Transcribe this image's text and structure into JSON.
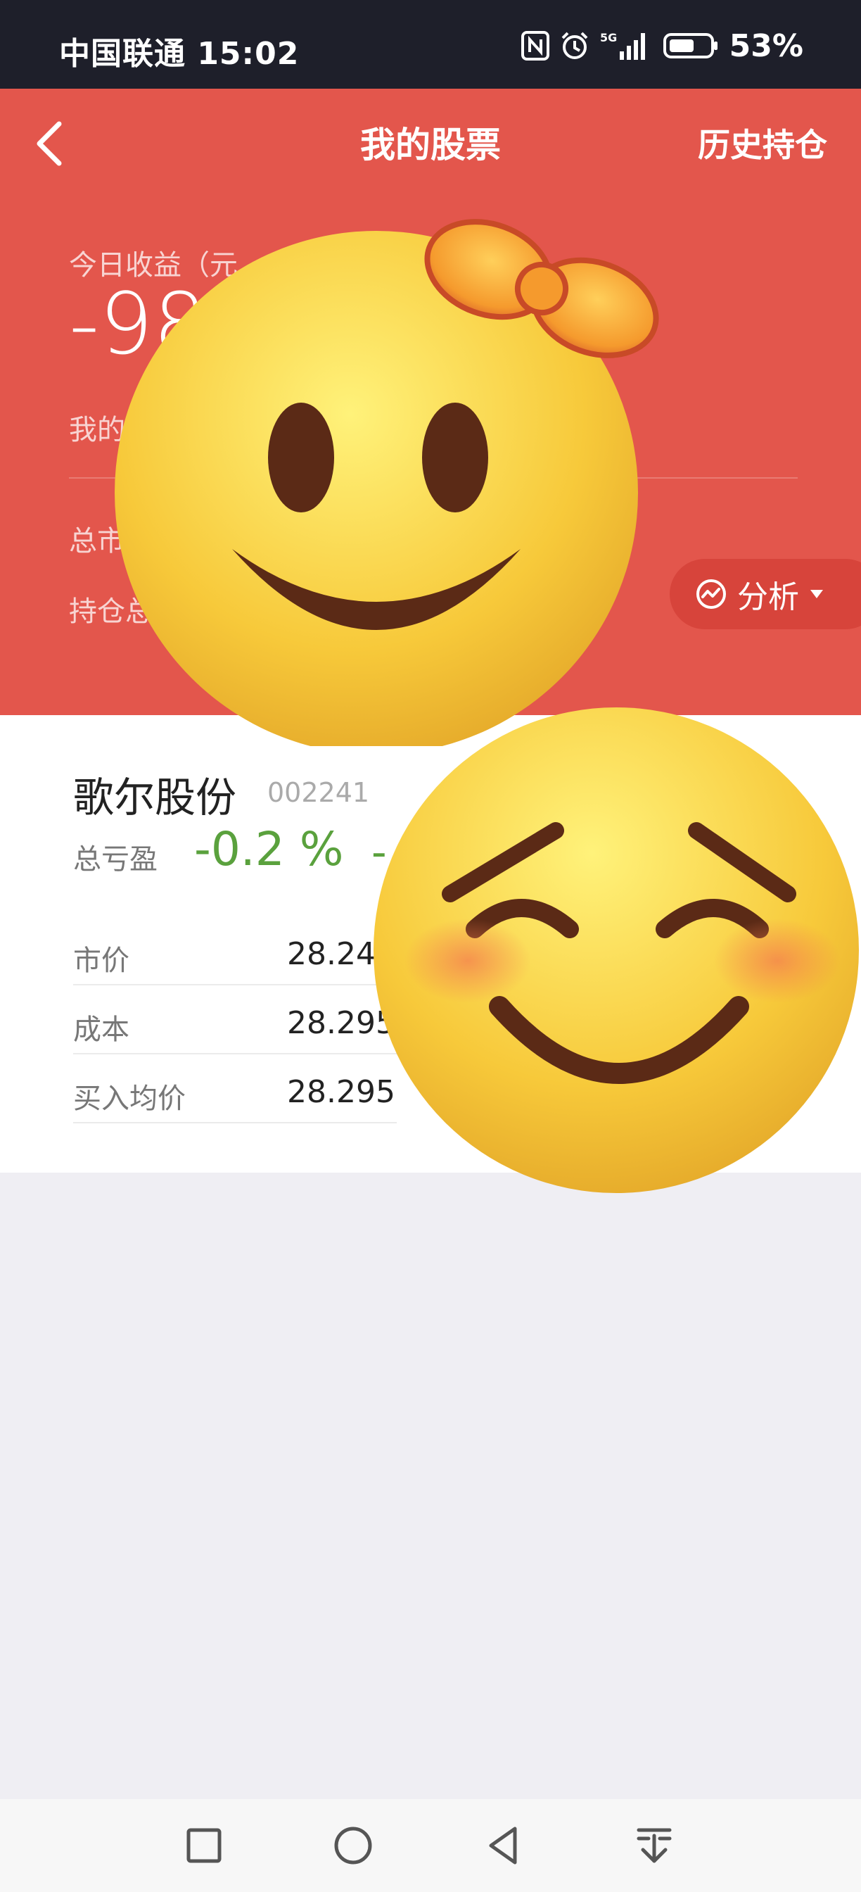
{
  "status_bar": {
    "carrier_time": "中国联通 15:02",
    "battery": "53%",
    "network": "5G",
    "icons": [
      "nfc-icon",
      "alarm-icon",
      "signal-icon",
      "battery-icon"
    ]
  },
  "header": {
    "title": "我的股票",
    "history": "历史持仓",
    "today_label": "今日收益（元",
    "today_value": "-98",
    "my_label": "我的",
    "total_label": "总市",
    "hold_label": "持仓总",
    "analysis": "分析"
  },
  "stock": {
    "name": "歌尔股份",
    "code": "002241",
    "pl_label": "总亏盈",
    "pl_pct": "-0.2 %",
    "pl_extra": "-",
    "rows": [
      {
        "label": "市价",
        "value": "28.24"
      },
      {
        "label": "成本",
        "value": "28.295"
      },
      {
        "label": "买入均价",
        "value": "28.295"
      }
    ]
  },
  "colors": {
    "header_red": "#e3564c",
    "loss_green": "#5aa13d"
  },
  "nav": [
    "recent-apps-icon",
    "home-icon",
    "back-triangle-icon",
    "notification-pull-icon"
  ]
}
